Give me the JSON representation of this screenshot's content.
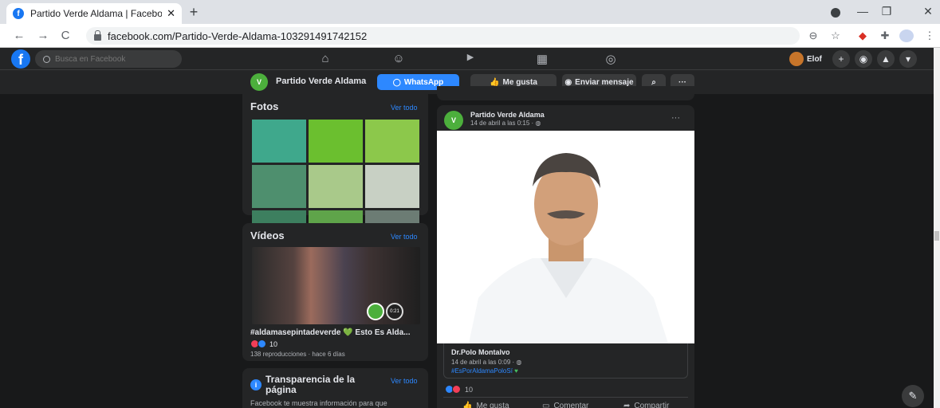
{
  "browser": {
    "tab_title": "Partido Verde Aldama | Facebook",
    "tab_close": "✕",
    "new_tab": "+",
    "url": "facebook.com/Partido-Verde-Aldama-103291491742152",
    "back": "←",
    "forward": "→",
    "reload": "C",
    "minimize": "—",
    "restore": "❐",
    "close": "✕"
  },
  "fb_header": {
    "logo": "f",
    "search_placeholder": "Busca en Facebook",
    "user_name": "Elof",
    "create": "+",
    "messenger": "◉",
    "notifications": "▲",
    "menu": "▾"
  },
  "page_bar": {
    "logo_text": "V",
    "page_name": "Partido Verde Aldama",
    "whatsapp": "WhatsApp",
    "like": "Me gusta",
    "message": "Enviar mensaje",
    "search": "⌕",
    "more": "···"
  },
  "photos": {
    "title": "Fotos",
    "see_all": "Ver todo",
    "colors": [
      "#3fa88c",
      "#6bbf2f",
      "#8cc84b",
      "#4e8f6e",
      "#a9c98a",
      "#c8d0c4",
      "#3d7f5f",
      "#5fa44a",
      "#6c7c74"
    ]
  },
  "videos": {
    "title": "Vídeos",
    "see_all": "Ver todo",
    "video_title": "#aldamasepintadeverde 💚 Esto Es Alda...",
    "reaction_count": "10",
    "meta": "138 reproducciones · hace 6 días",
    "badge_text": "0:21"
  },
  "transparency": {
    "title": "Transparencia de la página",
    "see_all": "Ver todo",
    "text": "Facebook te muestra información para que"
  },
  "post": {
    "author": "Partido Verde Aldama",
    "date": "14 de abril a las 0:15 · ",
    "more": "···",
    "shared_author": "Dr.Polo Montalvo",
    "shared_date": "14 de abril a las 0:09 · ",
    "hashtag": "#EsPorAldamaPoloSí",
    "reaction_count": "10",
    "like": "Me gusta",
    "comment": "Comentar",
    "share": "Compartir"
  },
  "icons": {
    "home": "⌂",
    "friends": "☺",
    "watch": "▶",
    "marketplace": "▦",
    "groups": "◎",
    "zoom": "⊖",
    "star": "☆",
    "ext1": "◆",
    "puzzle": "✚",
    "kebab": "⋮",
    "compose": "✎"
  }
}
